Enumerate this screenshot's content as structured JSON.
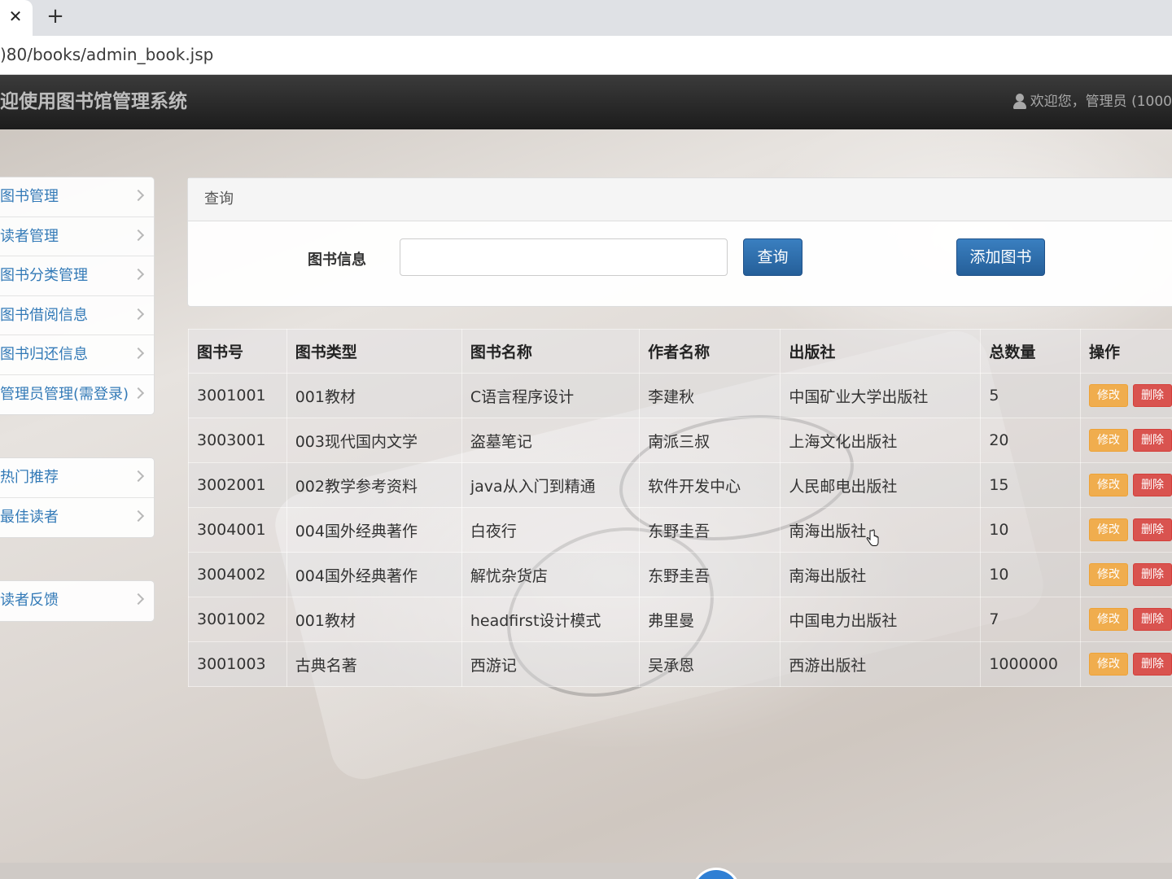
{
  "browser": {
    "close_glyph": "✕",
    "newtab_glyph": "+",
    "url": ")80/books/admin_book.jsp"
  },
  "navbar": {
    "brand": "迎使用图书馆管理系统",
    "user_text": "欢迎您，管理员 (1000"
  },
  "sidebar": {
    "group1": [
      "图书管理",
      "读者管理",
      "图书分类管理",
      "图书借阅信息",
      "图书归还信息",
      "管理员管理(需登录)"
    ],
    "group2": [
      "热门推荐",
      "最佳读者"
    ],
    "group3": [
      "读者反馈"
    ]
  },
  "query_panel": {
    "title": "查询",
    "label": "图书信息",
    "input_value": "",
    "query_button": "查询",
    "add_button": "添加图书"
  },
  "table": {
    "headers": [
      "图书号",
      "图书类型",
      "图书名称",
      "作者名称",
      "出版社",
      "总数量",
      "操作"
    ],
    "edit_label": "修改",
    "delete_label": "删除",
    "rows": [
      [
        "3001001",
        "001教材",
        "C语言程序设计",
        "李建秋",
        "中国矿业大学出版社",
        "5"
      ],
      [
        "3003001",
        "003现代国内文学",
        "盗墓笔记",
        "南派三叔",
        "上海文化出版社",
        "20"
      ],
      [
        "3002001",
        "002教学参考资料",
        "java从入门到精通",
        "软件开发中心",
        "人民邮电出版社",
        "15"
      ],
      [
        "3004001",
        "004国外经典著作",
        "白夜行",
        "东野圭吾",
        "南海出版社",
        "10"
      ],
      [
        "3004002",
        "004国外经典著作",
        "解忧杂货店",
        "东野圭吾",
        "南海出版社",
        "10"
      ],
      [
        "3001002",
        "001教材",
        "headfirst设计模式",
        "弗里曼",
        "中国电力出版社",
        "7"
      ],
      [
        "3001003",
        "古典名著",
        "西游记",
        "吴承恩",
        "西游出版社",
        "1000000"
      ]
    ]
  },
  "colors": {
    "link_blue": "#337ab7",
    "primary_button": "#2a6aa9",
    "warning": "#f0ad4e",
    "danger": "#d9534f"
  }
}
